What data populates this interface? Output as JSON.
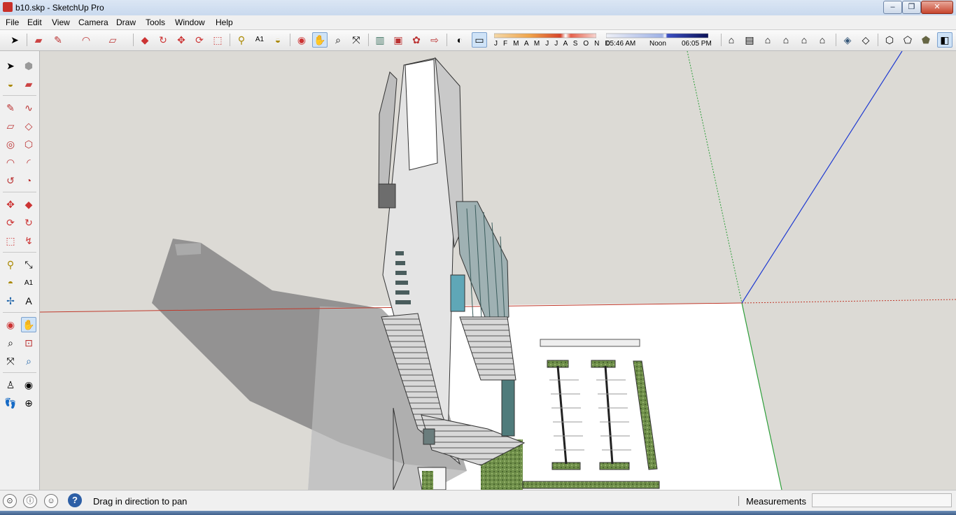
{
  "window": {
    "title": "b10.skp - SketchUp Pro",
    "minimize_label": "–",
    "maximize_label": "❐",
    "close_label": "✕"
  },
  "menu": [
    "File",
    "Edit",
    "View",
    "Camera",
    "Draw",
    "Tools",
    "Window",
    "Help"
  ],
  "toolbar": {
    "icons": [
      "select-icon",
      "eraser-icon",
      "pencil-icon",
      "arc-icon",
      "rectangle-icon",
      "push-pull-icon",
      "follow-me-icon",
      "move-icon",
      "rotate-icon",
      "scale-icon",
      "tape-measure-icon",
      "text-icon",
      "paint-bucket-icon",
      "orbit-icon",
      "pan-icon",
      "zoom-icon",
      "zoom-extents-icon",
      "get-models-icon",
      "share-model-icon",
      "components-icon",
      "extension-icon",
      "shadows-icon",
      "fog-icon",
      "iso-view-icon",
      "top-view-icon",
      "front-view-icon",
      "right-view-icon",
      "back-view-icon",
      "left-view-icon",
      "xray-icon",
      "wireframe-icon",
      "hidden-line-icon",
      "shaded-icon",
      "shaded-textures-icon",
      "monochrome-icon"
    ],
    "shadow_months": "J F M A M J J A S O N D",
    "time_start": "05:46 AM",
    "time_noon": "Noon",
    "time_end": "06:05 PM"
  },
  "palette": {
    "active_tool": "pan-icon",
    "icons": [
      "select-icon",
      "make-component-icon",
      "paint-bucket-icon",
      "eraser-icon",
      "pencil-icon",
      "freehand-icon",
      "rectangle-icon",
      "rotated-rectangle-icon",
      "circle-icon",
      "polygon-icon",
      "arc-icon",
      "two-point-arc-icon",
      "three-point-arc-icon",
      "pie-icon",
      "move-icon",
      "push-pull-icon",
      "rotate-icon",
      "follow-me-icon",
      "scale-icon",
      "offset-icon",
      "tape-measure-icon",
      "dimension-icon",
      "protractor-icon",
      "text-icon",
      "axes-icon",
      "3d-text-icon",
      "orbit-icon",
      "pan-icon",
      "zoom-icon",
      "zoom-window-icon",
      "zoom-extents-icon",
      "previous-view-icon",
      "position-camera-icon",
      "look-around-icon",
      "walk-icon",
      "section-plane-icon"
    ]
  },
  "statusbar": {
    "icons": [
      "geolocation-icon",
      "credits-icon",
      "user-icon",
      "help-icon"
    ],
    "help_label": "?",
    "message": "Drag in direction to pan",
    "measurements_label": "Measurements",
    "measurements_value": ""
  },
  "colors": {
    "axis_red": "#c0392b",
    "axis_green": "#2e9e3a",
    "axis_blue": "#1f3ad1",
    "sky": "#dcdad5",
    "ground": "#ffffff"
  }
}
